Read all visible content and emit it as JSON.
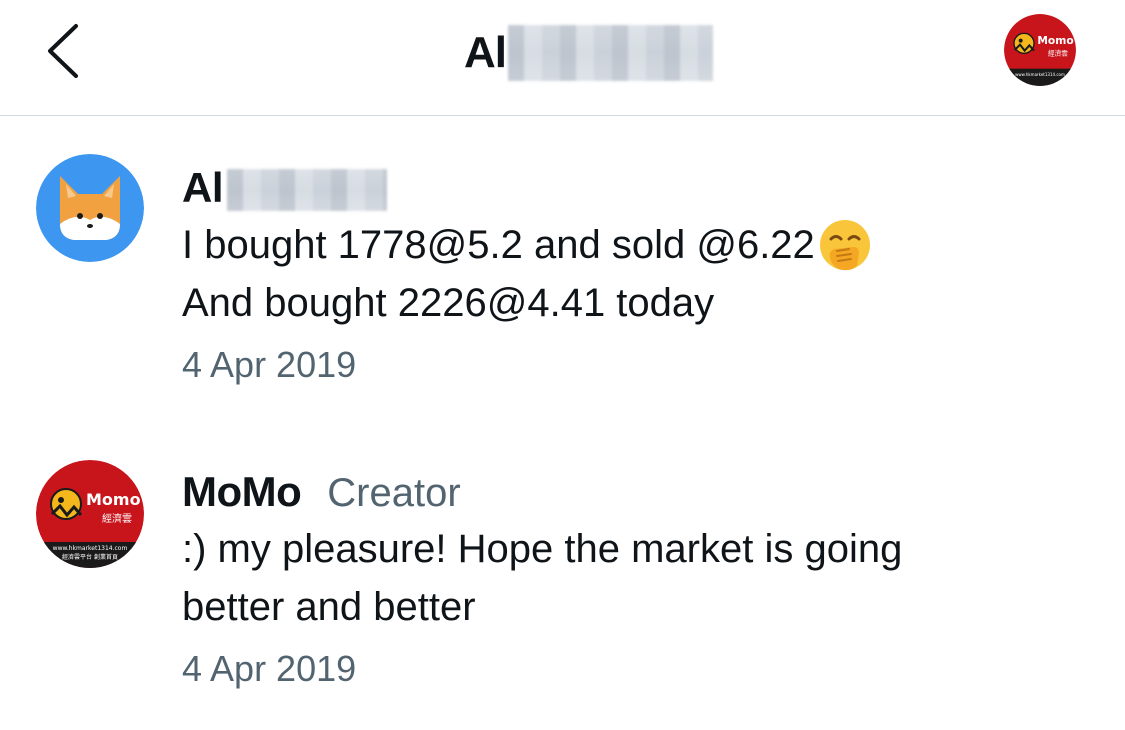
{
  "header": {
    "title_visible": "Al",
    "avatar_badge_text": "Momo",
    "avatar_badge_subtext": "經濟雲",
    "avatar_footer_text": "www.hkmarket1314.com"
  },
  "messages": [
    {
      "sender_visible": "Al",
      "sender_role": "",
      "lines": [
        "I bought 1778@5.2 and sold @6.22",
        "And bought 2226@4.41 today"
      ],
      "date": "4 Apr 2019",
      "emoji": "face-with-hand-over-mouth"
    },
    {
      "sender_visible": "MoMo",
      "sender_role": "Creator",
      "lines": [
        ":) my pleasure! Hope the market is going",
        "better and better"
      ],
      "date": "4 Apr 2019",
      "avatar_badge_text": "Momo",
      "avatar_badge_subtext": "經濟雲",
      "avatar_footer_text": "www.hkmarket1314.com",
      "avatar_footer_text2": "經濟雲平台 創業首頁"
    }
  ],
  "colors": {
    "text_primary": "#0f1419",
    "text_secondary": "#536471",
    "fox_avatar_bg": "#3d96ef",
    "momo_red": "#c8141b",
    "divider": "#cfd9de"
  }
}
